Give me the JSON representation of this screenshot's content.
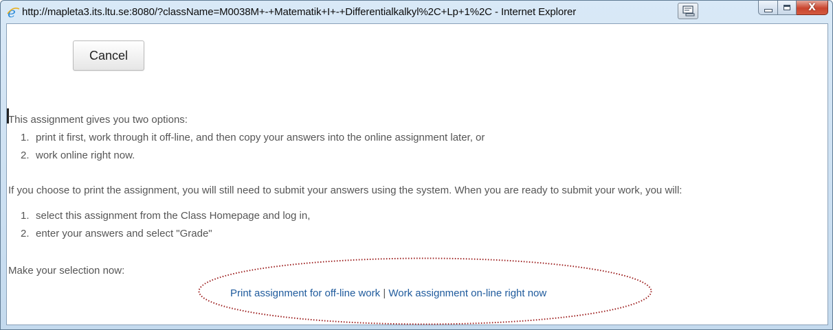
{
  "window": {
    "title": "http://mapleta3.its.ltu.se:8080/?className=M0038M+-+Matematik+I+-+Differentialkalkyl%2C+Lp+1%2C - Internet Explorer",
    "close_glyph": "X",
    "icons": [
      "ie-logo-icon",
      "compatibility-view-icon",
      "minimize-icon",
      "maximize-icon",
      "close-icon"
    ]
  },
  "toolbar": {
    "cancel_label": "Cancel"
  },
  "body": {
    "intro": "This assignment gives you two options:",
    "options": [
      {
        "num": "1.",
        "text": "print it first, work through it off-line, and then copy your answers into the online assignment later, or"
      },
      {
        "num": "2.",
        "text": "work online right now."
      }
    ],
    "print_note": "If you choose to print the assignment, you will still need to submit your answers using the system. When you are ready to submit your work, you will:",
    "steps": [
      {
        "num": "1.",
        "text": "select this assignment from the Class Homepage and log in,"
      },
      {
        "num": "2.",
        "text": "enter your answers and select \"Grade\""
      }
    ],
    "make_selection": "Make your selection now:",
    "link_print": "Print assignment for off-line work",
    "separator": "|",
    "link_online": "Work assignment on-line right now"
  },
  "colors": {
    "link": "#1e5a9c",
    "text": "#555555",
    "annotation_ellipse": "#9b1b1b",
    "close_button": "#c9452e"
  }
}
